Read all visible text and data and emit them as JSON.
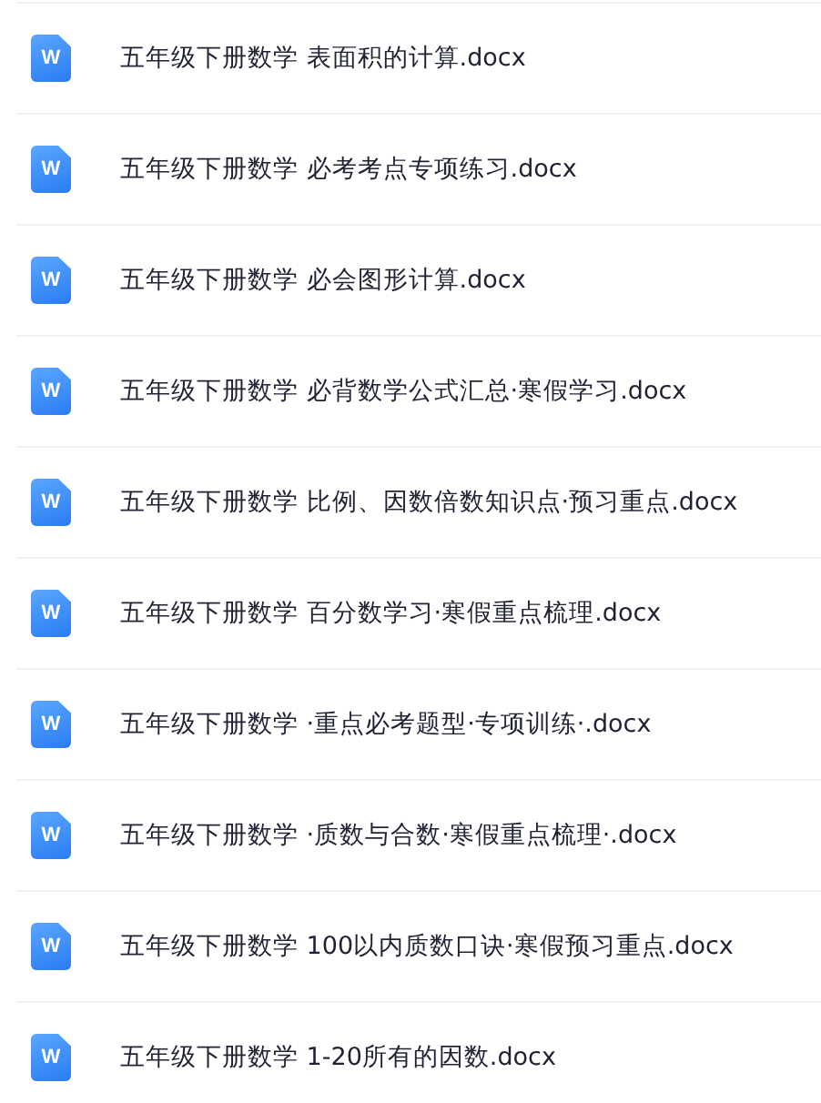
{
  "files": [
    {
      "icon_letter": "W",
      "name": "五年级下册数学 表面积的计算.docx"
    },
    {
      "icon_letter": "W",
      "name": "五年级下册数学 必考考点专项练习.docx"
    },
    {
      "icon_letter": "W",
      "name": "五年级下册数学 必会图形计算.docx"
    },
    {
      "icon_letter": "W",
      "name": "五年级下册数学 必背数学公式汇总·寒假学习.docx"
    },
    {
      "icon_letter": "W",
      "name": "五年级下册数学 比例、因数倍数知识点·预习重点.docx"
    },
    {
      "icon_letter": "W",
      "name": "五年级下册数学 百分数学习·寒假重点梳理.docx"
    },
    {
      "icon_letter": "W",
      "name": "五年级下册数学 ·重点必考题型·专项训练·.docx"
    },
    {
      "icon_letter": "W",
      "name": "五年级下册数学 ·质数与合数·寒假重点梳理·.docx"
    },
    {
      "icon_letter": "W",
      "name": "五年级下册数学 100以内质数口诀·寒假预习重点.docx"
    },
    {
      "icon_letter": "W",
      "name": "五年级下册数学 1-20所有的因数.docx"
    }
  ]
}
